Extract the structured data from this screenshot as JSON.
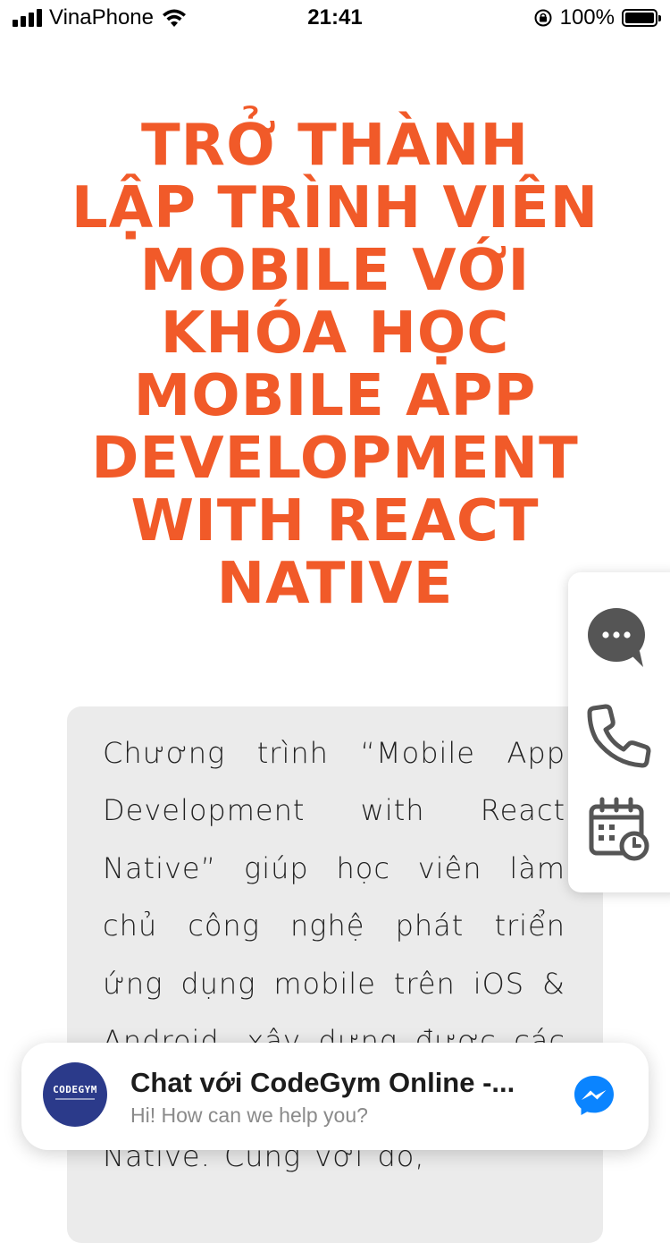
{
  "status_bar": {
    "carrier": "VinaPhone",
    "time": "21:41",
    "battery": "100%",
    "battery_level": 1.0,
    "icons": [
      "signal-icon",
      "wifi-icon",
      "rotation-lock-icon",
      "battery-icon"
    ]
  },
  "hero": {
    "title_lines": [
      "TRỞ THÀNH",
      "LẬP TRÌNH VIÊN",
      "MOBILE VỚI",
      "KHÓA HỌC",
      "MOBILE APP",
      "DEVELOPMENT",
      "WITH REACT",
      "NATIVE"
    ],
    "color": "#f15a29"
  },
  "description": {
    "text": "Chương trình “Mobile App Development with React Native” giúp học viên làm chủ công nghệ phát triển ứng dụng mobile trên iOS & Android, xây dựng được các ứng dụng mobile bằng React Native. Cùng với đó,"
  },
  "contact_panel": {
    "buttons": [
      {
        "icon": "chat-bubble-icon",
        "label": "Chat"
      },
      {
        "icon": "phone-icon",
        "label": "Call"
      },
      {
        "icon": "calendar-icon",
        "label": "Schedule"
      }
    ],
    "icon_color": "#555555"
  },
  "chat_widget": {
    "logo_text": "CODEGYM",
    "title": "Chat với CodeGym Online -...",
    "subtitle": "Hi! How can we help you?",
    "icon": "messenger-icon",
    "accent": "#0a84ff"
  }
}
